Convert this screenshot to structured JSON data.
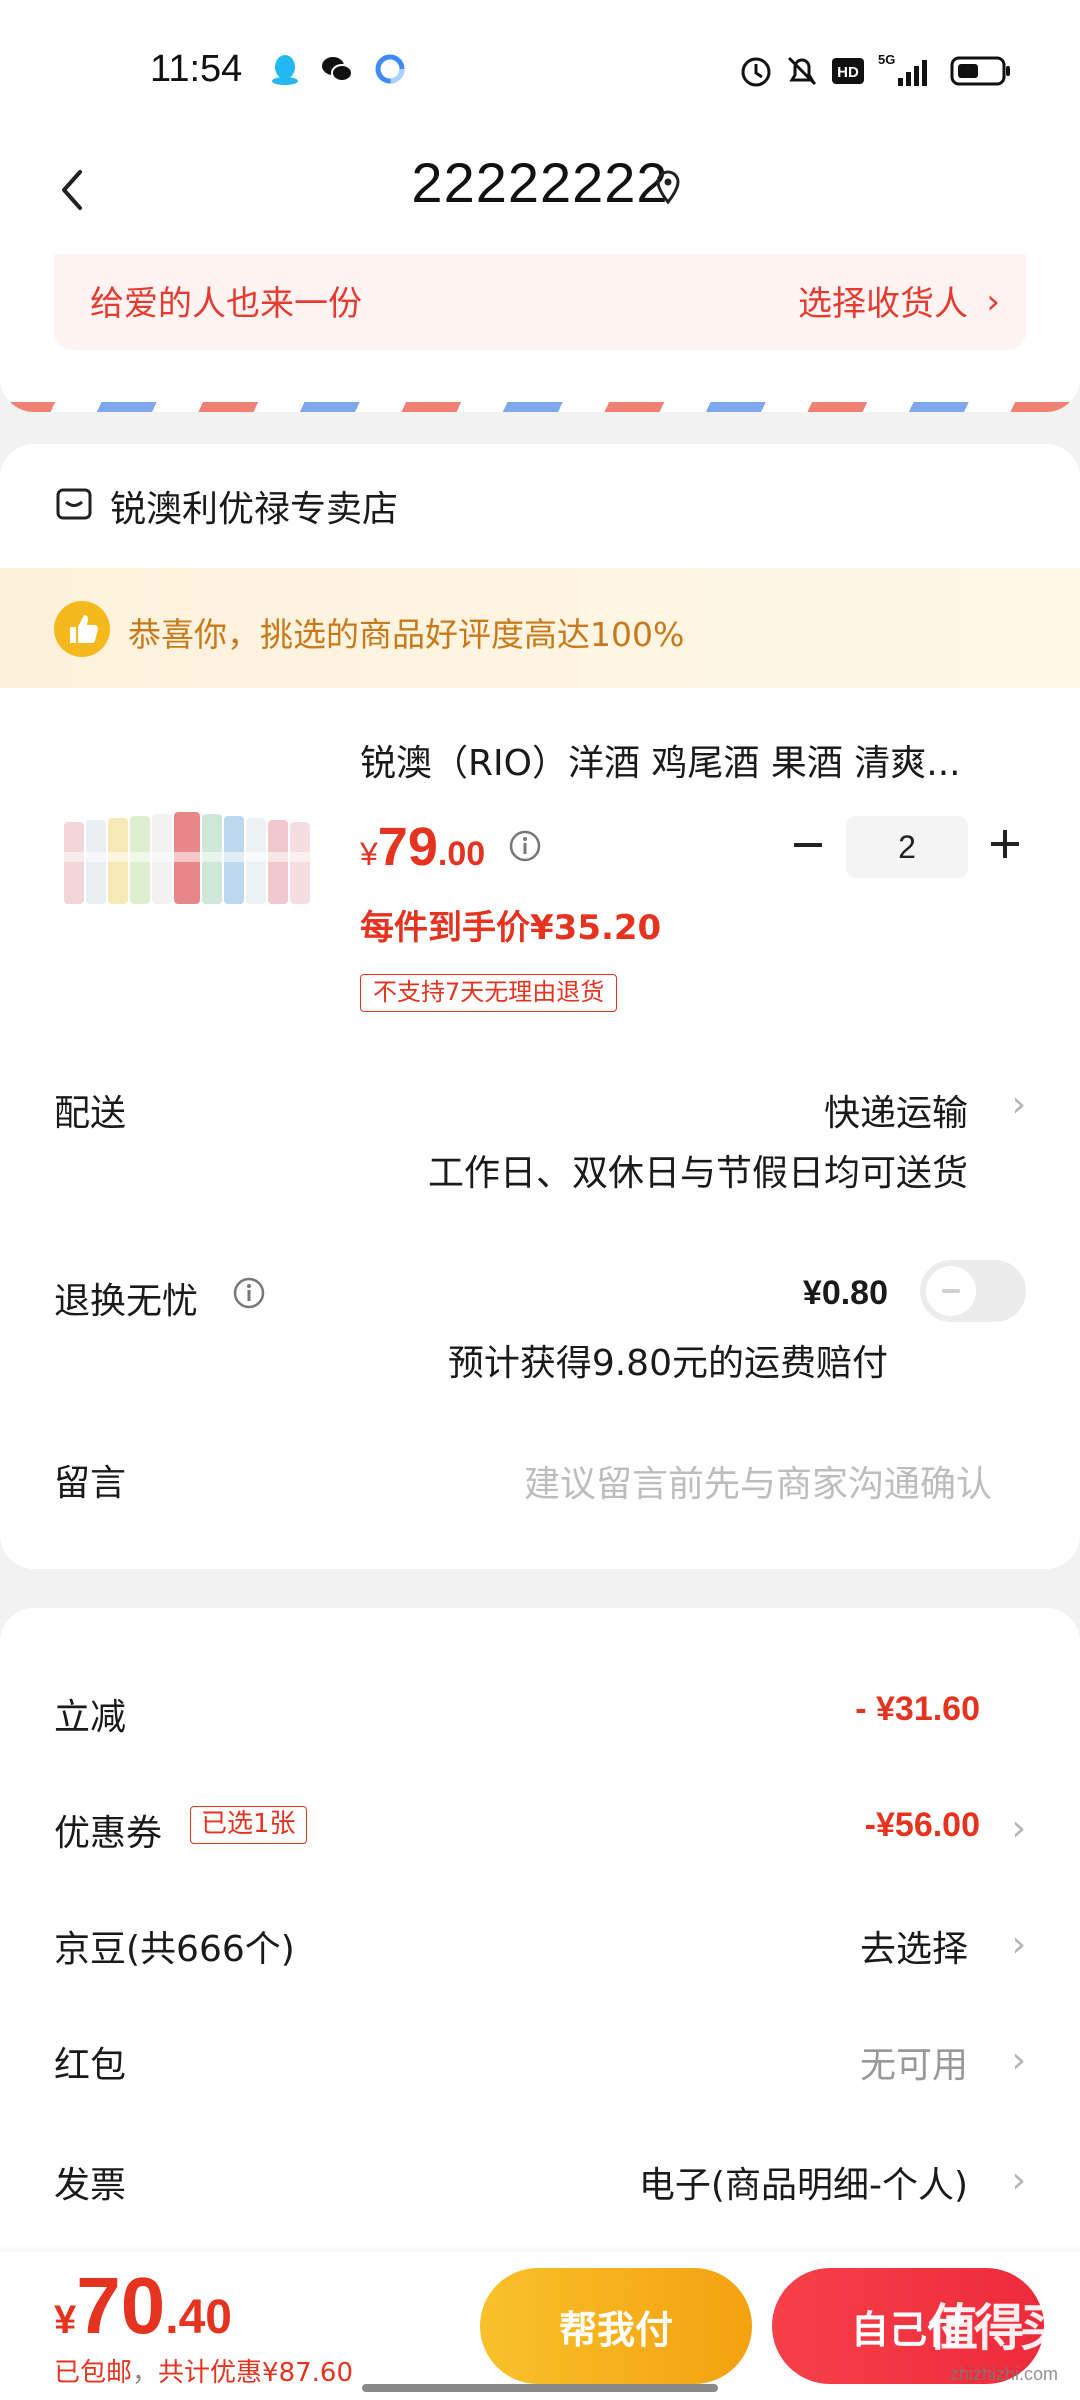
{
  "status_bar": {
    "time": "11:54",
    "left_icons": [
      "qq-icon",
      "wechat-icon",
      "browser-icon"
    ],
    "right_icons": [
      "alarm-icon",
      "mute-icon",
      "hd-icon",
      "5g-signal-icon",
      "battery-icon"
    ],
    "network": "5G",
    "hd": "HD"
  },
  "header": {
    "title": "22222222",
    "back_icon": "chevron-left-icon",
    "location_icon": "location-pin-icon"
  },
  "address": {
    "gift_text": "给爱的人也来一份",
    "gift_link": "选择收货人",
    "gift_chevron": "›"
  },
  "shop": {
    "name": "锐澳利优禄专卖店",
    "praise_text": "恭喜你，挑选的商品好评度高达100%",
    "product": {
      "title": "锐澳（RIO）洋酒 鸡尾酒 果酒 清爽...",
      "price_currency": "¥",
      "price_int": "79",
      "price_dec": ".00",
      "quantity": "2",
      "unit_price_text": "每件到手价¥35.20",
      "return_tag": "不支持7天无理由退货",
      "minus": "−",
      "plus": "+"
    },
    "delivery": {
      "label": "配送",
      "value": "快递运输",
      "sub": "工作日、双休日与节假日均可送货"
    },
    "return_insurance": {
      "label": "退换无忧",
      "price": "¥0.80",
      "sub": "预计获得9.80元的运费赔付",
      "enabled": false
    },
    "message": {
      "label": "留言",
      "placeholder": "建议留言前先与商家沟通确认"
    }
  },
  "discounts": {
    "instant": {
      "label": "立减",
      "value": "- ¥31.60"
    },
    "coupon": {
      "label": "优惠券",
      "tag": "已选1张",
      "value": "-¥56.00"
    },
    "jd_beans": {
      "label": "京豆(共666个)",
      "value": "去选择"
    },
    "red_packet": {
      "label": "红包",
      "value": "无可用"
    },
    "invoice": {
      "label": "发票",
      "value": "电子(商品明细-个人)"
    },
    "chevron": "›"
  },
  "bottom": {
    "currency": "¥",
    "total_int": "70",
    "total_dec": ".40",
    "free_shipping": "已包邮",
    "separator": "，",
    "savings": "共计优惠¥87.60",
    "help_pay_label": "帮我付",
    "self_pay_label": "自己付",
    "watermark": "值得买",
    "watermark_sub": "zhizhizhi.com"
  },
  "colors": {
    "accent_red": "#e5331f",
    "button_orange": "#f4a10f",
    "button_red": "#ee2a3a",
    "praise_text": "#c87a1a"
  }
}
